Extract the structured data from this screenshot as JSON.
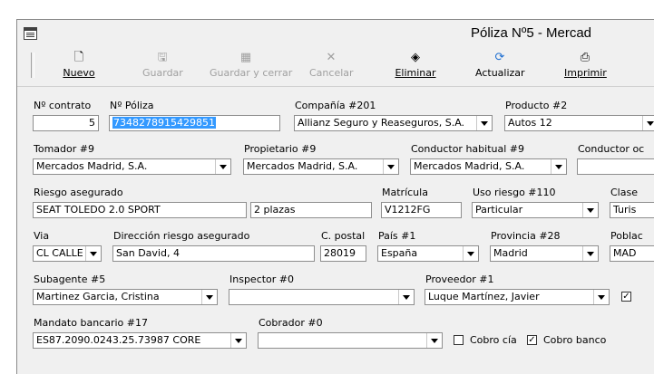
{
  "window": {
    "title": "Póliza Nº5 - Mercad"
  },
  "toolbar": {
    "nuevo": {
      "label": "Nuevo",
      "icon": "new-document-icon",
      "glyph": "🗋"
    },
    "guardar": {
      "label": "Guardar",
      "icon": "save-icon",
      "glyph": "🖫"
    },
    "guardar_cerrar": {
      "label": "Guardar y cerrar",
      "icon": "save-close-icon",
      "glyph": "▦"
    },
    "cancelar": {
      "label": "Cancelar",
      "icon": "cancel-icon",
      "glyph": "✕"
    },
    "eliminar": {
      "label": "Eliminar",
      "icon": "eraser-icon",
      "glyph": "◈"
    },
    "actualizar": {
      "label": "Actualizar",
      "icon": "refresh-icon",
      "glyph": "⟳"
    },
    "imprimir": {
      "label": "Imprimir",
      "icon": "printer-icon",
      "glyph": "⎙"
    }
  },
  "form": {
    "n_contrato": {
      "label": "Nº contrato",
      "value": "5"
    },
    "n_poliza": {
      "label": "Nº Póliza",
      "value": "7348278915429851"
    },
    "compania": {
      "label": "Compañía #201",
      "value": "Allianz Seguro y Reaseguros, S.A."
    },
    "producto": {
      "label": "Producto #2",
      "value": "Autos 12"
    },
    "tomador": {
      "label": "Tomador #9",
      "value": "Mercados Madrid, S.A."
    },
    "propietario": {
      "label": "Propietario #9",
      "value": "Mercados Madrid, S.A."
    },
    "conductor_habitual": {
      "label": "Conductor habitual #9",
      "value": "Mercados Madrid, S.A."
    },
    "conductor_oc": {
      "label": "Conductor oc",
      "value": ""
    },
    "riesgo": {
      "label": "Riesgo asegurado",
      "value": "SEAT TOLEDO 2.0 SPORT",
      "value2": "2 plazas"
    },
    "matricula": {
      "label": "Matrícula",
      "value": "V1212FG"
    },
    "uso_riesgo": {
      "label": "Uso riesgo #110",
      "value": "Particular"
    },
    "clase": {
      "label": "Clase",
      "value": "Turis"
    },
    "via": {
      "label": "Via",
      "value": "CL CALLE"
    },
    "direccion": {
      "label": "Dirección riesgo asegurado",
      "value": "San David, 4"
    },
    "cpostal": {
      "label": "C. postal",
      "value": "28019"
    },
    "pais": {
      "label": "País #1",
      "value": "España"
    },
    "provincia": {
      "label": "Provincia #28",
      "value": "Madrid"
    },
    "poblacion": {
      "label": "Poblac",
      "value": "MAD"
    },
    "subagente": {
      "label": "Subagente #5",
      "value": "Martinez Garcia, Cristina"
    },
    "inspector": {
      "label": "Inspector #0",
      "value": ""
    },
    "proveedor": {
      "label": "Proveedor #1",
      "value": "Luque Martínez, Javier"
    },
    "mandato": {
      "label": "Mandato bancario #17",
      "value": "ES87.2090.0243.25.73987 CORE"
    },
    "cobrador": {
      "label": "Cobrador #0",
      "value": ""
    },
    "cobro_cia": {
      "label": "Cobro cía",
      "checked": false
    },
    "cobro_banco": {
      "label": "Cobro banco",
      "checked": true
    },
    "proveedor_check": {
      "checked": true
    }
  }
}
